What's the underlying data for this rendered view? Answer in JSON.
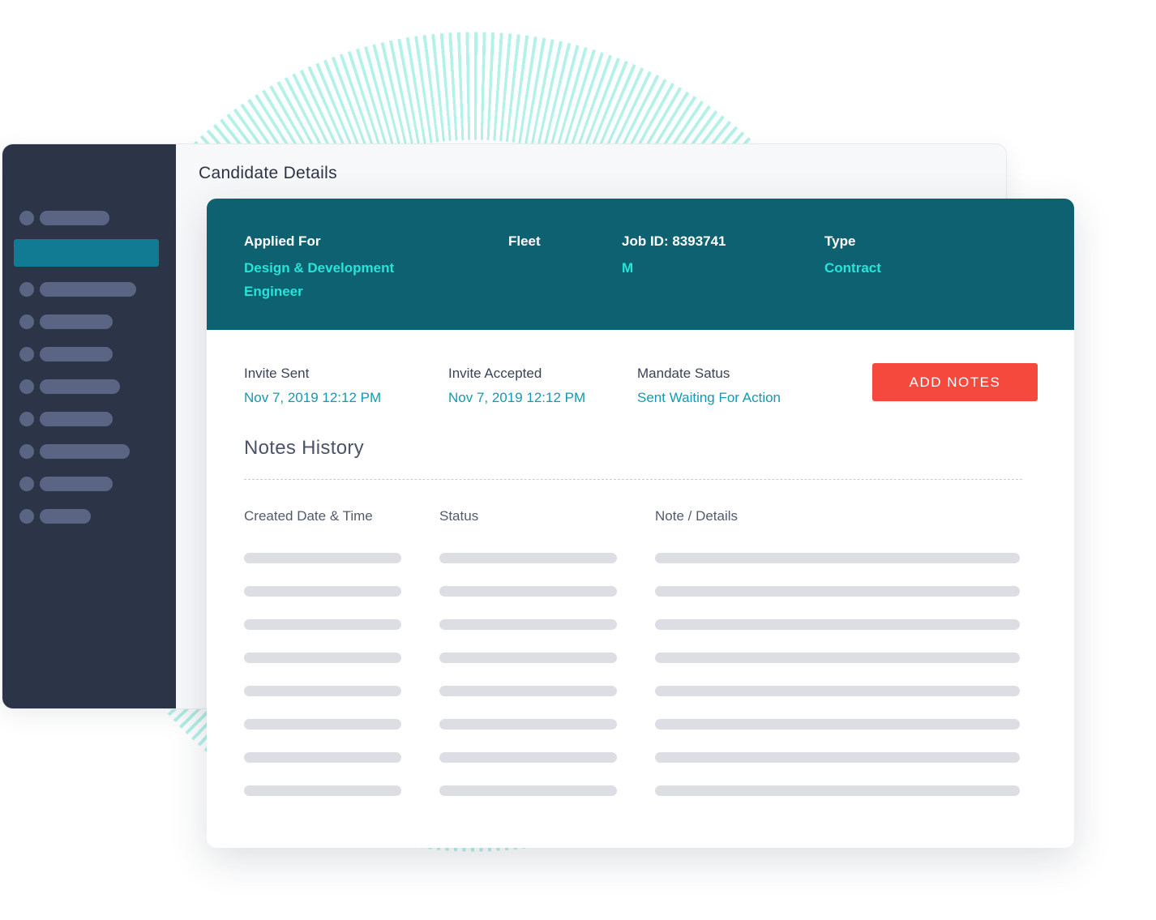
{
  "page": {
    "title": "Candidate Details"
  },
  "sidebar": {
    "items": [
      {
        "icon": "menu-item-placeholder"
      },
      {
        "icon": "menu-item-placeholder",
        "active": true
      },
      {
        "icon": "menu-item-placeholder"
      },
      {
        "icon": "menu-item-placeholder"
      },
      {
        "icon": "menu-item-placeholder"
      },
      {
        "icon": "menu-item-placeholder"
      },
      {
        "icon": "menu-item-placeholder"
      },
      {
        "icon": "menu-item-placeholder"
      },
      {
        "icon": "menu-item-placeholder"
      },
      {
        "icon": "menu-item-placeholder"
      }
    ]
  },
  "job_header": {
    "applied_for_label": "Applied For",
    "applied_for_value_line1": "Design & Development",
    "applied_for_value_line2": "Engineer",
    "fleet_label": "Fleet",
    "job_id_label": "Job ID: 8393741",
    "job_id_value": "M",
    "type_label": "Type",
    "type_value": "Contract"
  },
  "invite": {
    "sent_label": "Invite Sent",
    "sent_value": "Nov 7, 2019 12:12 PM",
    "accepted_label": "Invite Accepted",
    "accepted_value": "Nov 7, 2019 12:12 PM",
    "mandate_label": "Mandate Satus",
    "mandate_value": "Sent Waiting For Action"
  },
  "actions": {
    "add_notes_label": "ADD NOTES"
  },
  "notes": {
    "title": "Notes History",
    "columns": [
      "Created Date & Time",
      "Status",
      "Note / Details"
    ],
    "placeholder_rows": 8
  },
  "colors": {
    "sidebar_bg": "#2c3447",
    "sidebar_active": "#107b92",
    "header_bg": "#0e6170",
    "header_value": "#27e3d8",
    "link_value": "#1499b2",
    "primary_button": "#f5493e",
    "skeleton": "#dcdee4"
  }
}
